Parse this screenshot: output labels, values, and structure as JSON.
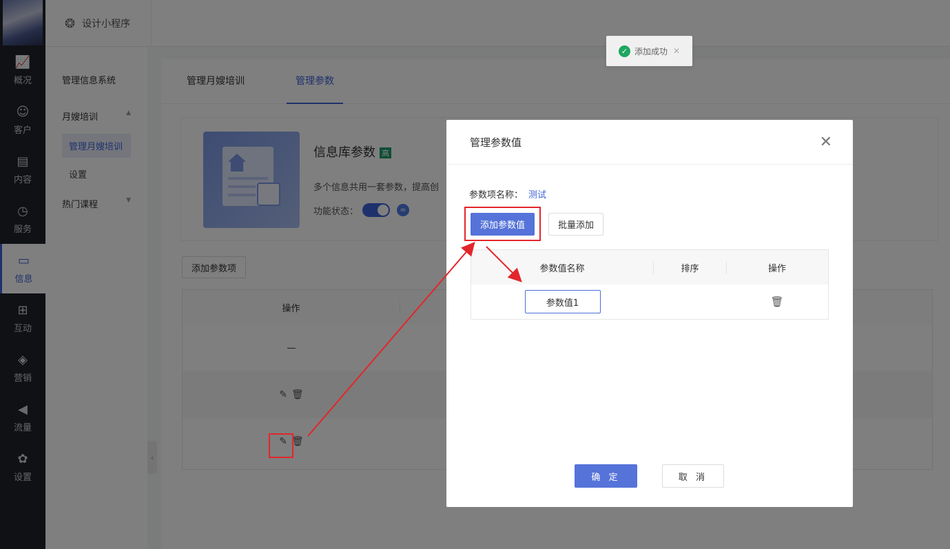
{
  "nav": {
    "items": [
      {
        "label": "概况",
        "icon": "chart-icon"
      },
      {
        "label": "客户",
        "icon": "user-icon"
      },
      {
        "label": "内容",
        "icon": "document-icon"
      },
      {
        "label": "服务",
        "icon": "service-icon"
      },
      {
        "label": "信息",
        "icon": "message-icon"
      },
      {
        "label": "互动",
        "icon": "gamepad-icon"
      },
      {
        "label": "营销",
        "icon": "tag-icon"
      },
      {
        "label": "流量",
        "icon": "megaphone-icon"
      },
      {
        "label": "设置",
        "icon": "gear-icon"
      }
    ],
    "active_index": 4
  },
  "topbar": {
    "brand": "设计小程序"
  },
  "subnav": {
    "system": "管理信息系统",
    "group1": "月嫂培训",
    "group1_items": [
      "管理月嫂培训",
      "设置"
    ],
    "group2": "热门课程"
  },
  "tabs": [
    "管理月嫂培训",
    "管理参数"
  ],
  "card": {
    "title": "信息库参数",
    "tag": "高",
    "desc": "多个信息共用一套参数，提高创",
    "state_label": "功能状态："
  },
  "main": {
    "add_item_button": "添加参数项",
    "table_header_op": "操作",
    "row1_op": "—"
  },
  "toast": {
    "text": "添加成功"
  },
  "modal": {
    "title": "管理参数值",
    "field_label": "参数项名称：",
    "field_value": "测试",
    "add_value_button": "添加参数值",
    "batch_add_button": "批量添加",
    "columns": [
      "参数值名称",
      "排序",
      "操作"
    ],
    "row_value": "参数值1",
    "ok_button": "确 定",
    "cancel_button": "取 消"
  },
  "colors": {
    "accent": "#3f63d9",
    "annotation": "#e3262b",
    "success": "#1ea760"
  }
}
